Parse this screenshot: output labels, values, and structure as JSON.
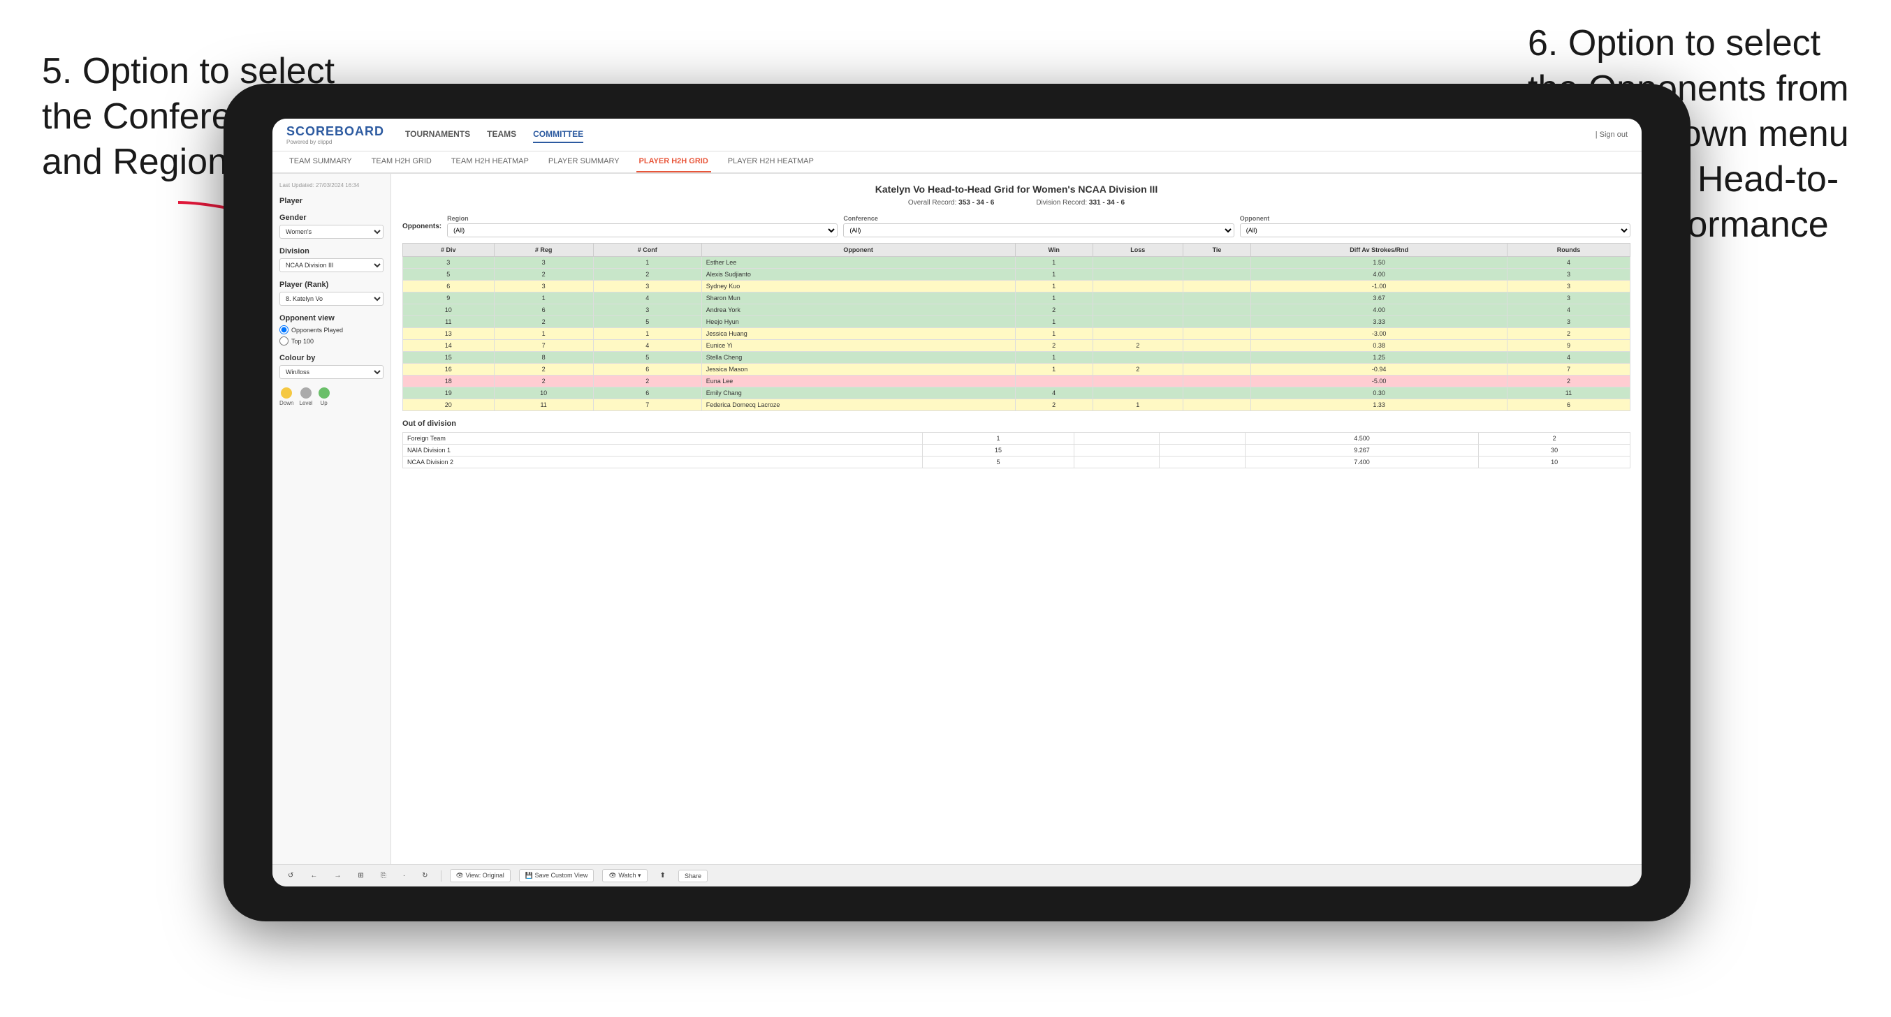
{
  "annotations": {
    "left": "5. Option to select the Conference and Region",
    "right": "6. Option to select the Opponents from the dropdown menu to see the Head-to-Head performance"
  },
  "nav": {
    "logo": "SCOREBOARD",
    "logo_sub": "Powered by clippd",
    "items": [
      "TOURNAMENTS",
      "TEAMS",
      "COMMITTEE"
    ],
    "header_right": "| Sign out"
  },
  "sub_nav": {
    "items": [
      "TEAM SUMMARY",
      "TEAM H2H GRID",
      "TEAM H2H HEATMAP",
      "PLAYER SUMMARY",
      "PLAYER H2H GRID",
      "PLAYER H2H HEATMAP"
    ]
  },
  "sidebar": {
    "last_updated": "Last Updated: 27/03/2024 16:34",
    "player_label": "Player",
    "gender_label": "Gender",
    "gender_value": "Women's",
    "division_label": "Division",
    "division_value": "NCAA Division III",
    "player_rank_label": "Player (Rank)",
    "player_rank_value": "8. Katelyn Vo",
    "opponent_view_label": "Opponent view",
    "opponent_played": "Opponents Played",
    "top100": "Top 100",
    "colour_by_label": "Colour by",
    "colour_by_value": "Win/loss",
    "legend": [
      {
        "color": "#f5c842",
        "label": "Down"
      },
      {
        "color": "#aaaaaa",
        "label": "Level"
      },
      {
        "color": "#6abf69",
        "label": "Up"
      }
    ]
  },
  "main": {
    "title": "Katelyn Vo Head-to-Head Grid for Women's NCAA Division III",
    "overall_record_label": "Overall Record:",
    "overall_record": "353 - 34 - 6",
    "division_record_label": "Division Record:",
    "division_record": "331 - 34 - 6",
    "filters": {
      "opponents_label": "Opponents:",
      "region_label": "Region",
      "region_value": "(All)",
      "conference_label": "Conference",
      "conference_value": "(All)",
      "opponent_label": "Opponent",
      "opponent_value": "(All)"
    },
    "table_headers": [
      "# Div",
      "# Reg",
      "# Conf",
      "Opponent",
      "Win",
      "Loss",
      "Tie",
      "Diff Av Strokes/Rnd",
      "Rounds"
    ],
    "rows": [
      {
        "div": "3",
        "reg": "3",
        "conf": "1",
        "opponent": "Esther Lee",
        "win": "1",
        "loss": "",
        "tie": "",
        "diff": "1.50",
        "rounds": "4",
        "color": "green"
      },
      {
        "div": "5",
        "reg": "2",
        "conf": "2",
        "opponent": "Alexis Sudjianto",
        "win": "1",
        "loss": "",
        "tie": "",
        "diff": "4.00",
        "rounds": "3",
        "color": "green"
      },
      {
        "div": "6",
        "reg": "3",
        "conf": "3",
        "opponent": "Sydney Kuo",
        "win": "1",
        "loss": "",
        "tie": "",
        "diff": "-1.00",
        "rounds": "3",
        "color": "yellow"
      },
      {
        "div": "9",
        "reg": "1",
        "conf": "4",
        "opponent": "Sharon Mun",
        "win": "1",
        "loss": "",
        "tie": "",
        "diff": "3.67",
        "rounds": "3",
        "color": "green"
      },
      {
        "div": "10",
        "reg": "6",
        "conf": "3",
        "opponent": "Andrea York",
        "win": "2",
        "loss": "",
        "tie": "",
        "diff": "4.00",
        "rounds": "4",
        "color": "green"
      },
      {
        "div": "11",
        "reg": "2",
        "conf": "5",
        "opponent": "Heejo Hyun",
        "win": "1",
        "loss": "",
        "tie": "",
        "diff": "3.33",
        "rounds": "3",
        "color": "green"
      },
      {
        "div": "13",
        "reg": "1",
        "conf": "1",
        "opponent": "Jessica Huang",
        "win": "1",
        "loss": "",
        "tie": "",
        "diff": "-3.00",
        "rounds": "2",
        "color": "yellow"
      },
      {
        "div": "14",
        "reg": "7",
        "conf": "4",
        "opponent": "Eunice Yi",
        "win": "2",
        "loss": "2",
        "tie": "",
        "diff": "0.38",
        "rounds": "9",
        "color": "yellow"
      },
      {
        "div": "15",
        "reg": "8",
        "conf": "5",
        "opponent": "Stella Cheng",
        "win": "1",
        "loss": "",
        "tie": "",
        "diff": "1.25",
        "rounds": "4",
        "color": "green"
      },
      {
        "div": "16",
        "reg": "2",
        "conf": "6",
        "opponent": "Jessica Mason",
        "win": "1",
        "loss": "2",
        "tie": "",
        "diff": "-0.94",
        "rounds": "7",
        "color": "yellow"
      },
      {
        "div": "18",
        "reg": "2",
        "conf": "2",
        "opponent": "Euna Lee",
        "win": "",
        "loss": "",
        "tie": "",
        "diff": "-5.00",
        "rounds": "2",
        "color": "red"
      },
      {
        "div": "19",
        "reg": "10",
        "conf": "6",
        "opponent": "Emily Chang",
        "win": "4",
        "loss": "",
        "tie": "",
        "diff": "0.30",
        "rounds": "11",
        "color": "green"
      },
      {
        "div": "20",
        "reg": "11",
        "conf": "7",
        "opponent": "Federica Domecq Lacroze",
        "win": "2",
        "loss": "1",
        "tie": "",
        "diff": "1.33",
        "rounds": "6",
        "color": "yellow"
      }
    ],
    "out_of_division_title": "Out of division",
    "out_of_division_rows": [
      {
        "opponent": "Foreign Team",
        "win": "1",
        "loss": "",
        "tie": "",
        "diff": "4.500",
        "rounds": "2"
      },
      {
        "opponent": "NAIA Division 1",
        "win": "15",
        "loss": "",
        "tie": "",
        "diff": "9.267",
        "rounds": "30"
      },
      {
        "opponent": "NCAA Division 2",
        "win": "5",
        "loss": "",
        "tie": "",
        "diff": "7.400",
        "rounds": "10"
      }
    ]
  },
  "toolbar": {
    "view_original": "View: Original",
    "save_custom": "Save Custom View",
    "watch": "Watch ▾",
    "share": "Share"
  }
}
